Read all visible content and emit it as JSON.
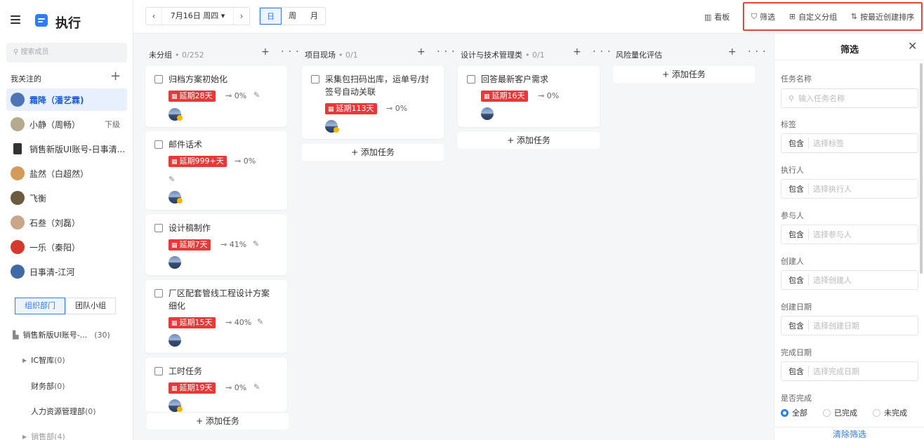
{
  "app": {
    "title": "执行"
  },
  "sidebar": {
    "search_placeholder": "搜索成员",
    "section_title": "我关注的",
    "section_add": "+",
    "members": [
      {
        "name": "霜降（潘艺霖)",
        "active": true,
        "color": "#4d74b5"
      },
      {
        "name": "小静（周畅）",
        "tail": "下级",
        "color": "#b5a98f"
      },
      {
        "name": "销售新版UI账号-日事清...",
        "color": "#333333"
      },
      {
        "name": "盐然（白超然）",
        "color": "#d49a5a"
      },
      {
        "name": "飞衡",
        "color": "#6c5b3e"
      },
      {
        "name": "石叁（刘磊）",
        "color": "#c9a58a"
      },
      {
        "name": "一乐（秦阳）",
        "color": "#d43a2b"
      },
      {
        "name": "日事清-江河",
        "color": "#3f6aa6"
      }
    ],
    "tabs": {
      "org": "组织部门",
      "team": "团队小组"
    },
    "org": [
      {
        "name": "销售新版UI账号-...",
        "count": "(30)"
      },
      {
        "name": "IC智库",
        "count": "(0)"
      },
      {
        "name": "财务部",
        "count": "(0)"
      },
      {
        "name": "人力资源管理部",
        "count": "(0)"
      },
      {
        "name": "销售部",
        "count": "(4)"
      }
    ]
  },
  "toolbar": {
    "prev": "‹",
    "date": "7月16日 周四 ▾",
    "next": "›",
    "views": [
      "日",
      "周",
      "月"
    ],
    "board": "看板",
    "filter": "筛选",
    "group": "自定义分组",
    "sort": "按最近创建排序"
  },
  "columns": [
    {
      "title": "未分组",
      "count": "0/252",
      "tasks": [
        {
          "title": "归档方案初始化",
          "badge": "延期28天",
          "progress": "0%"
        },
        {
          "title": "邮件话术",
          "badge": "延期999+天",
          "progress": "0%"
        },
        {
          "title": "设计稿制作",
          "badge": "延期7天",
          "progress": "41%"
        },
        {
          "title": "厂区配套管线工程设计方案细化",
          "badge": "延期15天",
          "progress": "40%"
        },
        {
          "title": "工时任务",
          "badge": "延期19天",
          "progress": "0%"
        }
      ]
    },
    {
      "title": "项目现场",
      "count": "0/1",
      "tasks": [
        {
          "title": "采集包扫码出库，运单号/封签号自动关联",
          "badge": "延期113天",
          "progress": "0%"
        }
      ]
    },
    {
      "title": "设计与技术管理类",
      "count": "0/1",
      "tasks": [
        {
          "title": "回答最新客户需求",
          "badge": "延期16天",
          "progress": "0%"
        }
      ]
    },
    {
      "title": "风险量化评估",
      "count": "",
      "tasks": []
    }
  ],
  "add_task": "+ 添加任务",
  "col_actions": "+ ···",
  "filter_panel": {
    "title": "筛选",
    "close": "✕",
    "task_name_label": "任务名称",
    "task_name_placeholder": "输入任务名称",
    "include": "包含",
    "fields": [
      {
        "label": "标签",
        "placeholder": "选择标签"
      },
      {
        "label": "执行人",
        "placeholder": "选择执行人"
      },
      {
        "label": "参与人",
        "placeholder": "选择参与人"
      },
      {
        "label": "创建人",
        "placeholder": "选择创建人"
      },
      {
        "label": "创建日期",
        "placeholder": "选择创建日期"
      },
      {
        "label": "完成日期",
        "placeholder": "选择完成日期"
      }
    ],
    "done_label": "是否完成",
    "done_options": [
      "全部",
      "已完成",
      "未完成"
    ],
    "clear": "清除筛选"
  },
  "colors": {
    "accent": "#2f7cf6",
    "overdue": "#e83838",
    "highlight_box": "#e0473a"
  }
}
